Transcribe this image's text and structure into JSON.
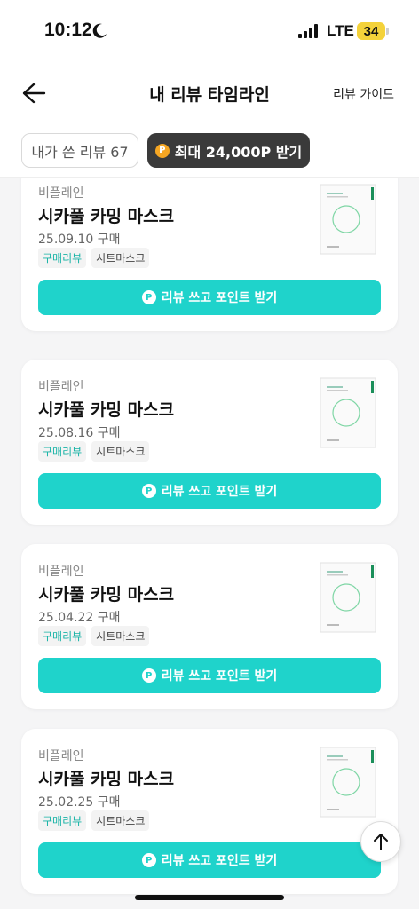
{
  "status_bar": {
    "time": "10:12",
    "network": "LTE",
    "battery": "34"
  },
  "header": {
    "title": "내 리뷰 타임라인",
    "guide_label": "리뷰 가이드"
  },
  "chips": {
    "count_label": "내가 쓴 리뷰 67",
    "point_label": "최대 24,000P 받기",
    "point_icon": "P"
  },
  "reviews": [
    {
      "brand": "비플레인",
      "product": "시카풀 카밍 마스크",
      "date": "25.09.10 구매",
      "tag1": "구매리뷰",
      "tag2": "시트마스크",
      "button": "리뷰 쓰고 포인트 받기"
    },
    {
      "brand": "비플레인",
      "product": "시카풀 카밍 마스크",
      "date": "25.08.16 구매",
      "tag1": "구매리뷰",
      "tag2": "시트마스크",
      "button": "리뷰 쓰고 포인트 받기"
    },
    {
      "brand": "비플레인",
      "product": "시카풀 카밍 마스크",
      "date": "25.04.22 구매",
      "tag1": "구매리뷰",
      "tag2": "시트마스크",
      "button": "리뷰 쓰고 포인트 받기"
    },
    {
      "brand": "비플레인",
      "product": "시카풀 카밍 마스크",
      "date": "25.02.25 구매",
      "tag1": "구매리뷰",
      "tag2": "시트마스크",
      "button": "리뷰 쓰고 포인트 받기"
    }
  ],
  "button_icon": "P",
  "colors": {
    "accent": "#1fd3cb",
    "tag_green": "#17b3a6",
    "dark_chip": "#3a3a3a",
    "coin": "#f5a623",
    "battery": "#f4d23a"
  }
}
